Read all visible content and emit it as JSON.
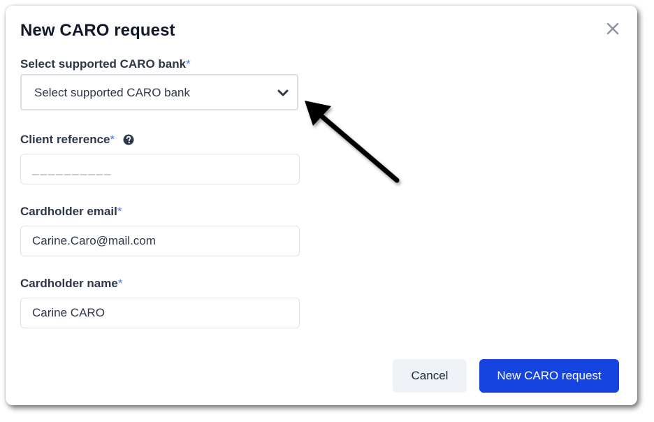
{
  "dialog": {
    "title": "New CARO request",
    "close_icon": "close-icon"
  },
  "form": {
    "bank": {
      "label": "Select supported CARO bank",
      "required_mark": "*",
      "selected_value": "Select supported CARO bank",
      "icon": "chevron-down-icon"
    },
    "client_reference": {
      "label": "Client reference",
      "required_mark": "*",
      "help_icon": "question-circle-icon",
      "value": "",
      "placeholder": "__________"
    },
    "cardholder_email": {
      "label": "Cardholder email",
      "required_mark": "*",
      "value": "Carine.Caro@mail.com"
    },
    "cardholder_name": {
      "label": "Cardholder name",
      "required_mark": "*",
      "value": "Carine CARO"
    }
  },
  "footer": {
    "cancel_label": "Cancel",
    "submit_label": "New CARO request"
  },
  "annotation": {
    "icon": "arrow-pointer-icon"
  },
  "colors": {
    "primary": "#1544e0",
    "required": "#4f7cf7",
    "cancel_bg": "#eff2f6",
    "title_text": "#0f1729"
  }
}
